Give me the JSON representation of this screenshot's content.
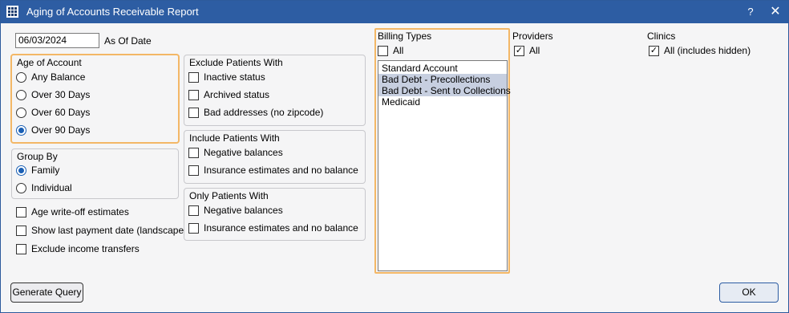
{
  "window": {
    "title": "Aging of Accounts Receivable Report",
    "help": "?",
    "close": "✕"
  },
  "as_of": {
    "value": "06/03/2024",
    "label": "As Of Date"
  },
  "age_of_account": {
    "title": "Age of Account",
    "options": [
      {
        "label": "Any Balance",
        "selected": false
      },
      {
        "label": "Over 30 Days",
        "selected": false
      },
      {
        "label": "Over 60 Days",
        "selected": false
      },
      {
        "label": "Over 90 Days",
        "selected": true
      }
    ]
  },
  "group_by": {
    "title": "Group By",
    "options": [
      {
        "label": "Family",
        "selected": true
      },
      {
        "label": "Individual",
        "selected": false
      }
    ]
  },
  "options": [
    {
      "label": "Age write-off estimates",
      "checked": false
    },
    {
      "label": "Show last payment date (landscape)",
      "checked": false
    },
    {
      "label": "Exclude income transfers",
      "checked": false
    }
  ],
  "exclude": {
    "title": "Exclude Patients With",
    "items": [
      {
        "label": "Inactive status",
        "checked": false
      },
      {
        "label": "Archived status",
        "checked": false
      },
      {
        "label": "Bad addresses (no zipcode)",
        "checked": false
      }
    ]
  },
  "include": {
    "title": "Include Patients With",
    "items": [
      {
        "label": "Negative balances",
        "checked": false
      },
      {
        "label": "Insurance estimates and no balance",
        "checked": false
      }
    ]
  },
  "only": {
    "title": "Only Patients With",
    "items": [
      {
        "label": "Negative balances",
        "checked": false
      },
      {
        "label": "Insurance estimates and no balance",
        "checked": false
      }
    ]
  },
  "billing_types": {
    "title": "Billing Types",
    "all_label": "All",
    "all_checked": false,
    "items": [
      {
        "label": "Standard Account",
        "selected": false
      },
      {
        "label": "Bad Debt - Precollections",
        "selected": true
      },
      {
        "label": "Bad Debt - Sent to Collections",
        "selected": true
      },
      {
        "label": "Medicaid",
        "selected": false
      }
    ]
  },
  "providers": {
    "title": "Providers",
    "all_label": "All",
    "all_checked": true
  },
  "clinics": {
    "title": "Clinics",
    "all_label": "All (includes hidden)",
    "all_checked": true
  },
  "buttons": {
    "generate": "Generate Query",
    "ok": "OK"
  },
  "colors": {
    "title_bar": "#2d5da3",
    "highlight": "#f3b766",
    "selection": "#c7cfe0",
    "radio_accent": "#1a5fb4"
  }
}
